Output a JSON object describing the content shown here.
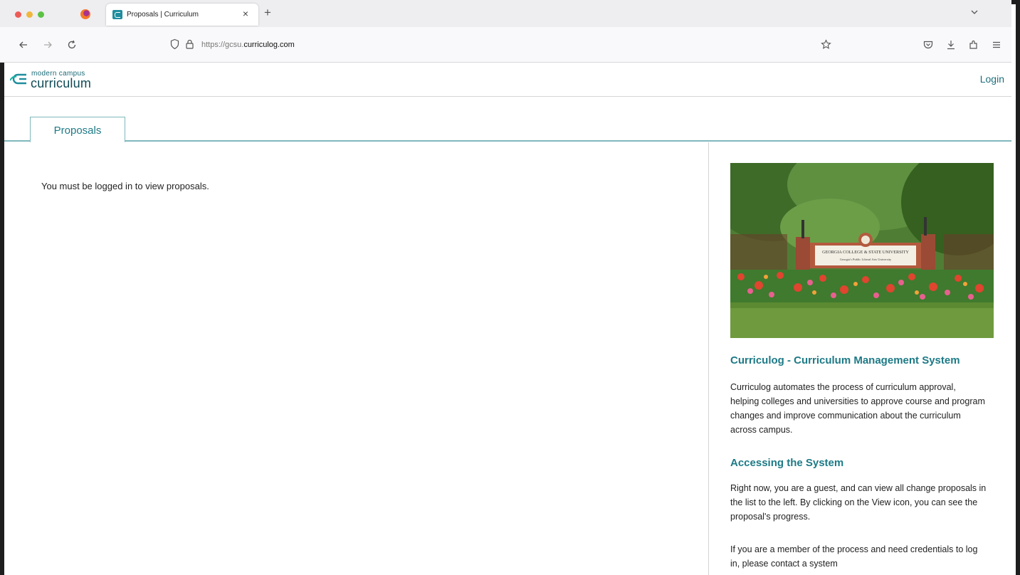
{
  "browser": {
    "tab_title": "Proposals | Curriculum",
    "tab_close": "×",
    "new_tab": "+",
    "url_prefix": "https://gcsu.",
    "url_domain": "curriculog.com",
    "icons": [
      "firefox-icon",
      "back-icon",
      "forward-icon",
      "reload-icon",
      "shield-icon",
      "lock-icon",
      "bookmark-star-icon",
      "pocket-icon",
      "download-icon",
      "extensions-icon",
      "menu-icon",
      "tab-list-chevron-icon"
    ]
  },
  "site": {
    "logo_small": "modern campus",
    "logo_big": "curriculum",
    "login_label": "Login",
    "accent_color": "#1d7a86"
  },
  "tabs": {
    "proposals_label": "Proposals"
  },
  "main": {
    "message": "You must be logged in to view proposals."
  },
  "sidebar": {
    "image_sign_line1": "GEORGIA COLLEGE & STATE UNIVERSITY",
    "image_sign_line2": "Georgia's Public Liberal Arts University",
    "heading1": "Curriculog - Curriculum Management System",
    "paragraph1": "Curriculog automates the process of curriculum approval, helping colleges and universities to approve course and program changes and improve communication about the curriculum across campus.",
    "heading2": "Accessing the System",
    "paragraph2": "Right now, you are a guest, and can view all change proposals in the list to the left. By clicking on the View icon, you can see the proposal's progress.",
    "paragraph3": "If you are a member of the process and need credentials to log in, please contact a system"
  }
}
